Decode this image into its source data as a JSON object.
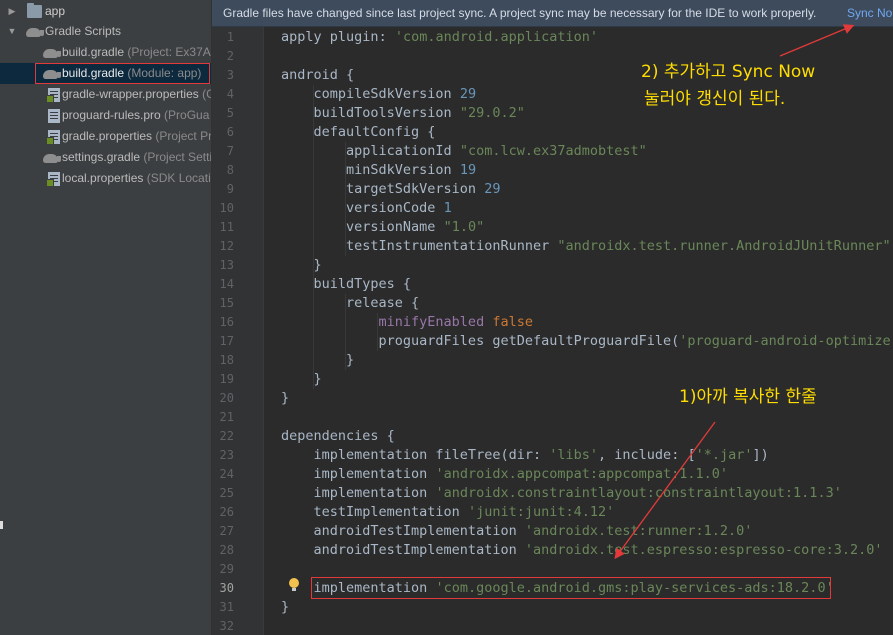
{
  "tree": {
    "items": [
      {
        "label": "app",
        "hint": "",
        "icon": "folder-icon"
      },
      {
        "label": "Gradle Scripts",
        "hint": "",
        "icon": "gradle-icon"
      },
      {
        "label": "build.gradle",
        "hint": " (Project: Ex37A",
        "icon": "gradle-icon"
      },
      {
        "label": "build.gradle",
        "hint": " (Module: app)",
        "icon": "gradle-icon"
      },
      {
        "label": "gradle-wrapper.properties",
        "hint": " (G",
        "icon": "file-icon"
      },
      {
        "label": "proguard-rules.pro",
        "hint": " (ProGua",
        "icon": "file-icon"
      },
      {
        "label": "gradle.properties",
        "hint": " (Project Pr",
        "icon": "file-icon"
      },
      {
        "label": "settings.gradle",
        "hint": " (Project Setti",
        "icon": "gradle-icon"
      },
      {
        "label": "local.properties",
        "hint": " (SDK Locatio",
        "icon": "file-icon"
      }
    ]
  },
  "notification": {
    "message": "Gradle files have changed since last project sync. A project sync may be necessary for the IDE to work properly.",
    "link": "Sync No"
  },
  "editor": {
    "lines": [
      [
        [
          "kw",
          "apply "
        ],
        [
          "kw",
          "plugin"
        ],
        [
          "kw",
          ": "
        ],
        [
          "str",
          "'com.android.application'"
        ]
      ],
      [],
      [
        [
          "kw",
          "android {"
        ]
      ],
      [
        [
          "kw",
          "    compileSdkVersion "
        ],
        [
          "num",
          "29"
        ]
      ],
      [
        [
          "kw",
          "    buildToolsVersion "
        ],
        [
          "str",
          "\"29.0.2\""
        ]
      ],
      [
        [
          "kw",
          "    defaultConfig {"
        ]
      ],
      [
        [
          "kw",
          "        applicationId "
        ],
        [
          "str",
          "\"com.lcw.ex37admobtest\""
        ]
      ],
      [
        [
          "kw",
          "        minSdkVersion "
        ],
        [
          "num",
          "19"
        ]
      ],
      [
        [
          "kw",
          "        targetSdkVersion "
        ],
        [
          "num",
          "29"
        ]
      ],
      [
        [
          "kw",
          "        versionCode "
        ],
        [
          "num",
          "1"
        ]
      ],
      [
        [
          "kw",
          "        versionName "
        ],
        [
          "str",
          "\"1.0\""
        ]
      ],
      [
        [
          "kw",
          "        testInstrumentationRunner "
        ],
        [
          "str",
          "\"androidx.test.runner.AndroidJUnitRunner\""
        ]
      ],
      [
        [
          "kw",
          "    }"
        ]
      ],
      [
        [
          "kw",
          "    buildTypes {"
        ]
      ],
      [
        [
          "kw",
          "        release {"
        ]
      ],
      [
        [
          "purple",
          "            minifyEnabled "
        ],
        [
          "orange",
          "false"
        ]
      ],
      [
        [
          "kw",
          "            proguardFiles getDefaultProguardFile("
        ],
        [
          "str",
          "'proguard-android-optimize.t"
        ]
      ],
      [
        [
          "kw",
          "        }"
        ]
      ],
      [
        [
          "kw",
          "    }"
        ]
      ],
      [
        [
          "kw",
          "}"
        ]
      ],
      [],
      [
        [
          "kw",
          "dependencies {"
        ]
      ],
      [
        [
          "kw",
          "    implementation fileTree("
        ],
        [
          "kw",
          "dir"
        ],
        [
          "kw",
          ": "
        ],
        [
          "str",
          "'libs'"
        ],
        [
          "kw",
          ", "
        ],
        [
          "kw",
          "include"
        ],
        [
          "kw",
          ": ["
        ],
        [
          "str",
          "'*.jar'"
        ],
        [
          "kw",
          "])"
        ]
      ],
      [
        [
          "kw",
          "    implementation "
        ],
        [
          "str",
          "'androidx.appcompat:appcompat:1.1.0'"
        ]
      ],
      [
        [
          "kw",
          "    implementation "
        ],
        [
          "str",
          "'androidx.constraintlayout:constraintlayout:1.1.3'"
        ]
      ],
      [
        [
          "kw",
          "    testImplementation "
        ],
        [
          "str",
          "'junit:junit:4.12'"
        ]
      ],
      [
        [
          "kw",
          "    androidTestImplementation "
        ],
        [
          "str",
          "'androidx.test:runner:1.2.0'"
        ]
      ],
      [
        [
          "kw",
          "    androidTestImplementation "
        ],
        [
          "str",
          "'androidx.test.espresso:espresso-core:3.2.0'"
        ]
      ],
      [],
      [
        [
          "kw",
          "    implementation "
        ],
        [
          "str",
          "'com.google.android.gms:play-services-ads:18.2.0'"
        ]
      ],
      [
        [
          "kw",
          "}"
        ]
      ],
      []
    ],
    "active_line": 30
  },
  "annotations": {
    "sync_note_line1": "2) 추가하고 Sync Now",
    "sync_note_line2": "눌러야 갱신이 된다.",
    "copied_note": "1)아까 복사한 한줄",
    "color": "#ffdd00",
    "arrow_color": "#e23a3a"
  }
}
